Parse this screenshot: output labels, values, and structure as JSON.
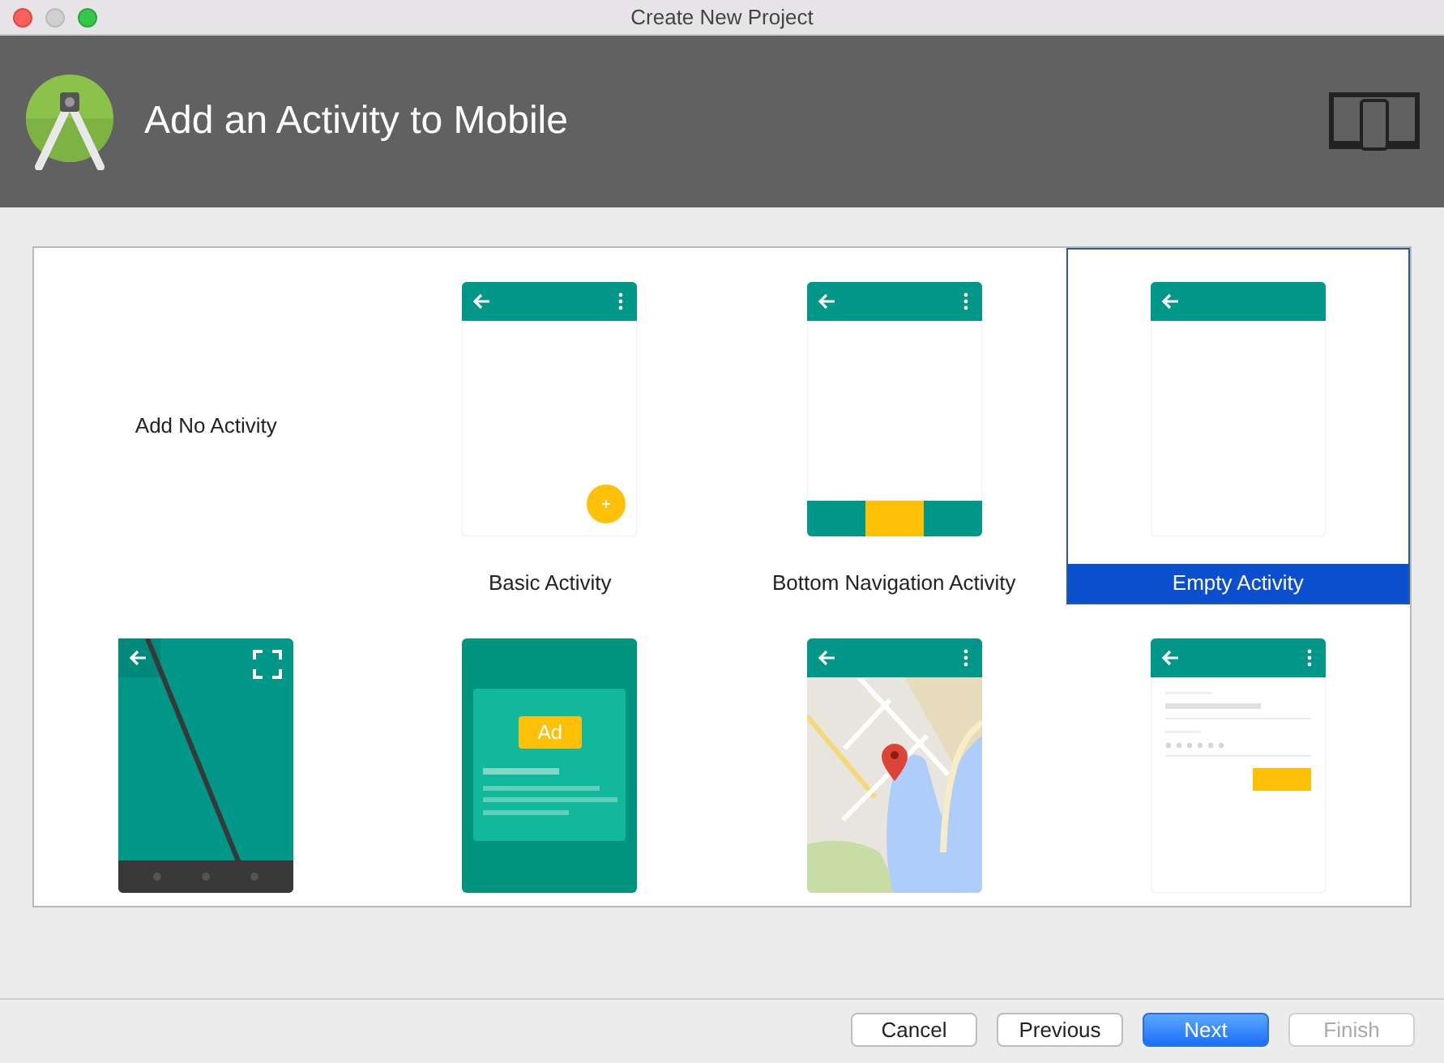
{
  "window": {
    "title": "Create New Project"
  },
  "header": {
    "title": "Add an Activity to Mobile"
  },
  "templates": [
    {
      "kind": "none",
      "label": "Add No Activity",
      "selected": false
    },
    {
      "kind": "basic",
      "label": "Basic Activity",
      "selected": false
    },
    {
      "kind": "bottom_nav",
      "label": "Bottom Navigation Activity",
      "selected": false
    },
    {
      "kind": "empty",
      "label": "Empty Activity",
      "selected": true
    },
    {
      "kind": "fullscreen",
      "selected": false
    },
    {
      "kind": "ads",
      "ad_text": "Ad",
      "selected": false
    },
    {
      "kind": "maps",
      "selected": false
    },
    {
      "kind": "login",
      "selected": false
    }
  ],
  "buttons": [
    {
      "label": "Cancel",
      "kind": "default",
      "disabled": false
    },
    {
      "label": "Previous",
      "kind": "default",
      "disabled": false
    },
    {
      "label": "Next",
      "kind": "primary",
      "disabled": false
    },
    {
      "label": "Finish",
      "kind": "default",
      "disabled": true
    }
  ]
}
